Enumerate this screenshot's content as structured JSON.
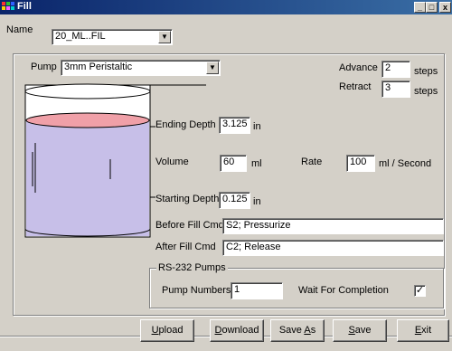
{
  "window": {
    "title": "Fill",
    "min": "_",
    "max": "□",
    "close": "x"
  },
  "name_field": {
    "label": "Name",
    "value": "20_ML..FIL"
  },
  "pump": {
    "label": "Pump",
    "value": "3mm Peristaltic"
  },
  "advance": {
    "label": "Advance",
    "value": "2",
    "unit": "steps"
  },
  "retract": {
    "label": "Retract",
    "value": "3",
    "unit": "steps"
  },
  "ending_depth": {
    "label": "Ending Depth",
    "value": "3.125",
    "unit": "in"
  },
  "volume": {
    "label": "Volume",
    "value": "60",
    "unit": "ml"
  },
  "rate": {
    "label": "Rate",
    "value": "100",
    "unit": "ml / Second"
  },
  "starting_depth": {
    "label": "Starting Depth",
    "value": "0.125",
    "unit": "in"
  },
  "before_fill": {
    "label": "Before Fill Cmd",
    "value": "S2; Pressurize"
  },
  "after_fill": {
    "label": "After Fill Cmd",
    "value": "C2; Release"
  },
  "rs232": {
    "title": "RS-232 Pumps",
    "pump_numbers_label": "Pump Numbers",
    "pump_numbers_value": "1",
    "wait_label": "Wait For Completion",
    "wait_checked": "✓"
  },
  "buttons": {
    "upload": {
      "first": "U",
      "rest": "pload"
    },
    "download": {
      "first": "D",
      "rest": "ownload"
    },
    "save_as": {
      "pre": "Save ",
      "key": "A",
      "post": "s"
    },
    "save": {
      "first": "S",
      "rest": "ave"
    },
    "exit": {
      "first": "E",
      "rest": "xit"
    }
  },
  "colors": {
    "liquid_fill": "#c7bfe8",
    "liquid_top": "#f0a0a8",
    "titlebar": "#0a246a"
  }
}
